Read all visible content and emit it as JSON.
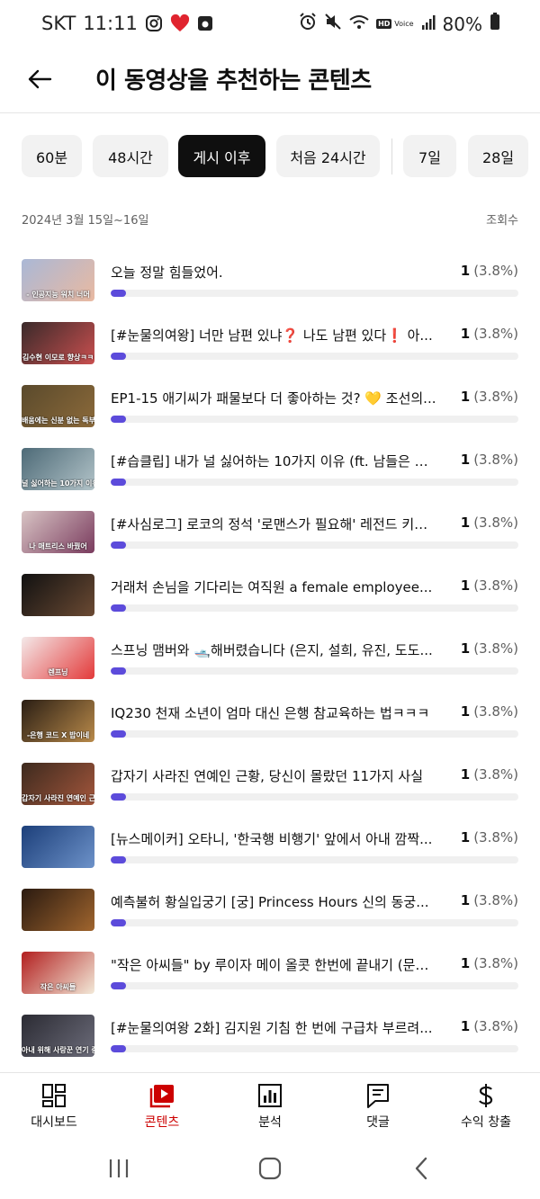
{
  "status": {
    "carrier": "SKT",
    "time": "11:11",
    "battery": "80%",
    "hd_label": "HD",
    "voice_label": "Voice",
    "left_icons": [
      "instagram-icon",
      "heart-icon",
      "app-square-icon"
    ],
    "right_icons": [
      "alarm-icon",
      "mute-icon",
      "wifi-icon",
      "signal-icon",
      "battery-icon"
    ]
  },
  "header": {
    "title": "이 동영상을 추천하는 콘텐츠",
    "back_icon": "back-arrow-icon"
  },
  "chips": [
    {
      "label": "60분",
      "active": false
    },
    {
      "label": "48시간",
      "active": false
    },
    {
      "label": "게시 이후",
      "active": true
    },
    {
      "label": "처음 24시간",
      "active": false
    },
    {
      "label": "7일",
      "active": false
    },
    {
      "label": "28일",
      "active": false
    }
  ],
  "range": {
    "label": "2024년 3월 15일~16일",
    "metric": "조회수"
  },
  "items": [
    {
      "title": "오늘 정말 힘들었어.",
      "count": "1",
      "percent": "(3.8%)",
      "share": 0.038,
      "thumb_text": "- 인공지능 워치 너머",
      "thumb_colors": [
        "#aab8d6",
        "#e9b9a1"
      ]
    },
    {
      "title": "[#눈물의여왕] 너만 남편 있냐❓ 나도 남편 있다❗ 아...",
      "count": "1",
      "percent": "(3.8%)",
      "share": 0.038,
      "thumb_text": "김수현 이모로 향상ㅋㅋ",
      "thumb_colors": [
        "#3a2a2a",
        "#c94f4f"
      ]
    },
    {
      "title": "EP1-15 애기씨가 패물보다 더 좋아하는 것? 💛 조선의...",
      "count": "1",
      "percent": "(3.8%)",
      "share": 0.038,
      "thumb_text": "배움에는 신분 없는 독부 미지는 법",
      "thumb_colors": [
        "#5a4a2c",
        "#8c6a3a"
      ]
    },
    {
      "title": "[#습클립] 내가 널 싫어하는 10가지 이유 (ft. 남들은 모...",
      "count": "1",
      "percent": "(3.8%)",
      "share": 0.038,
      "thumb_text": "널 싫어하는 10가지 이유",
      "thumb_colors": [
        "#4d6a77",
        "#b3c4c9"
      ]
    },
    {
      "title": "[#사심로그] 로코의 정석 '로맨스가 필요해' 레전드 키스...",
      "count": "1",
      "percent": "(3.8%)",
      "share": 0.038,
      "thumb_text": "나 매트리스 바꿨어",
      "thumb_colors": [
        "#d8c4c4",
        "#7a3b5e"
      ]
    },
    {
      "title": "거래처 손님을 기다리는 여직원 a female employee...",
      "count": "1",
      "percent": "(3.8%)",
      "share": 0.038,
      "thumb_text": "",
      "thumb_colors": [
        "#111111",
        "#6b4a33"
      ]
    },
    {
      "title": "스프닝 맴버와 🛥️해버렸습니다 (은지, 설희, 유진, 도도...",
      "count": "1",
      "percent": "(3.8%)",
      "share": 0.038,
      "thumb_text": "렌프닝",
      "thumb_colors": [
        "#f4e9e9",
        "#e33a3a"
      ]
    },
    {
      "title": "IQ230 천재 소년이 엄마 대신 은행 참교육하는 법ㅋㅋㅋ",
      "count": "1",
      "percent": "(3.8%)",
      "share": 0.038,
      "thumb_text": "-은행 코드 X 밥이네",
      "thumb_colors": [
        "#2a1e14",
        "#b98a4a"
      ]
    },
    {
      "title": "갑자기 사라진 연예인 근황, 당신이 몰랐던 11가지 사실",
      "count": "1",
      "percent": "(3.8%)",
      "share": 0.038,
      "thumb_text": "갑자기 사라진 연예인 근황",
      "thumb_colors": [
        "#3d2a1e",
        "#a3563c"
      ]
    },
    {
      "title": "[뉴스메이커] 오타니, '한국행 비행기' 앞에서 아내 깜짝...",
      "count": "1",
      "percent": "(3.8%)",
      "share": 0.038,
      "thumb_text": "",
      "thumb_colors": [
        "#1c3f7a",
        "#6d92c9"
      ]
    },
    {
      "title": "예측불허 황실입궁기 [궁] Princess Hours 신의 동궁...",
      "count": "1",
      "percent": "(3.8%)",
      "share": 0.038,
      "thumb_text": "",
      "thumb_colors": [
        "#2a1a10",
        "#a0652e"
      ]
    },
    {
      "title": "\"작은 아씨들\" by 루이자 메이 올콧 한번에 끝내기 (문학...",
      "count": "1",
      "percent": "(3.8%)",
      "share": 0.038,
      "thumb_text": "작은 아씨들",
      "thumb_colors": [
        "#b21f1f",
        "#f2e9d8"
      ]
    },
    {
      "title": "[#눈물의여왕 2화] 김지원 기침 한 번에 구급차 부르려...",
      "count": "1",
      "percent": "(3.8%)",
      "share": 0.038,
      "thumb_text": "아내 위해 사랑꾼 연기 중 키스까지 해버린다",
      "thumb_colors": [
        "#2b2b33",
        "#6c6c7a"
      ]
    }
  ],
  "bottom_nav": [
    {
      "label": "대시보드",
      "icon": "dashboard-icon",
      "active": false
    },
    {
      "label": "콘텐츠",
      "icon": "content-play-icon",
      "active": true
    },
    {
      "label": "분석",
      "icon": "analytics-chart-icon",
      "active": false
    },
    {
      "label": "댓글",
      "icon": "comments-icon",
      "active": false
    },
    {
      "label": "수익 창출",
      "icon": "dollar-icon",
      "active": false
    }
  ],
  "system_nav": [
    "recent-apps-icon",
    "home-icon",
    "system-back-icon"
  ],
  "colors": {
    "accent": "#cc0000",
    "bar": "#5c4bdb",
    "chip_active": "#0f0f0f",
    "chip_bg": "#f2f2f2"
  }
}
